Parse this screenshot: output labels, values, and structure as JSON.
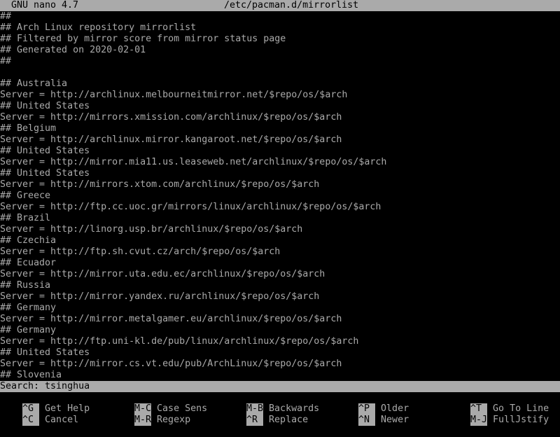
{
  "titlebar": {
    "program": "GNU nano 4.7",
    "filename": "/etc/pacman.d/mirrorlist"
  },
  "editor": {
    "lines": [
      "##",
      "## Arch Linux repository mirrorlist",
      "## Filtered by mirror score from mirror status page",
      "## Generated on 2020-02-01",
      "##",
      "",
      "## Australia",
      "Server = http://archlinux.melbourneitmirror.net/$repo/os/$arch",
      "## United States",
      "Server = http://mirrors.xmission.com/archlinux/$repo/os/$arch",
      "## Belgium",
      "Server = http://archlinux.mirror.kangaroot.net/$repo/os/$arch",
      "## United States",
      "Server = http://mirror.mia11.us.leaseweb.net/archlinux/$repo/os/$arch",
      "## United States",
      "Server = http://mirrors.xtom.com/archlinux/$repo/os/$arch",
      "## Greece",
      "Server = http://ftp.cc.uoc.gr/mirrors/linux/archlinux/$repo/os/$arch",
      "## Brazil",
      "Server = http://linorg.usp.br/archlinux/$repo/os/$arch",
      "## Czechia",
      "Server = http://ftp.sh.cvut.cz/arch/$repo/os/$arch",
      "## Ecuador",
      "Server = http://mirror.uta.edu.ec/archlinux/$repo/os/$arch",
      "## Russia",
      "Server = http://mirror.yandex.ru/archlinux/$repo/os/$arch",
      "## Germany",
      "Server = http://mirror.metalgamer.eu/archlinux/$repo/os/$arch",
      "## Germany",
      "Server = http://ftp.uni-kl.de/pub/linux/archlinux/$repo/os/$arch",
      "## United States",
      "Server = http://mirror.cs.vt.edu/pub/ArchLinux/$repo/os/$arch",
      "## Slovenia"
    ]
  },
  "search": {
    "label": "Search:",
    "value": "tsinghua",
    "display": "Search: tsinghua"
  },
  "shortcuts": [
    {
      "key": "^G",
      "label": "Get Help"
    },
    {
      "key": "M-C",
      "label": "Case Sens"
    },
    {
      "key": "M-B",
      "label": "Backwards"
    },
    {
      "key": "^P",
      "label": "Older"
    },
    {
      "key": "^T",
      "label": "Go To Line"
    },
    {
      "key": "^C",
      "label": "Cancel"
    },
    {
      "key": "M-R",
      "label": "Regexp"
    },
    {
      "key": "^R",
      "label": "Replace"
    },
    {
      "key": "^N",
      "label": "Newer"
    },
    {
      "key": "M-J",
      "label": "FullJstify"
    }
  ],
  "colors": {
    "background": "#000000",
    "foreground": "#aaaaaa",
    "bar": "#aaaaaa"
  }
}
